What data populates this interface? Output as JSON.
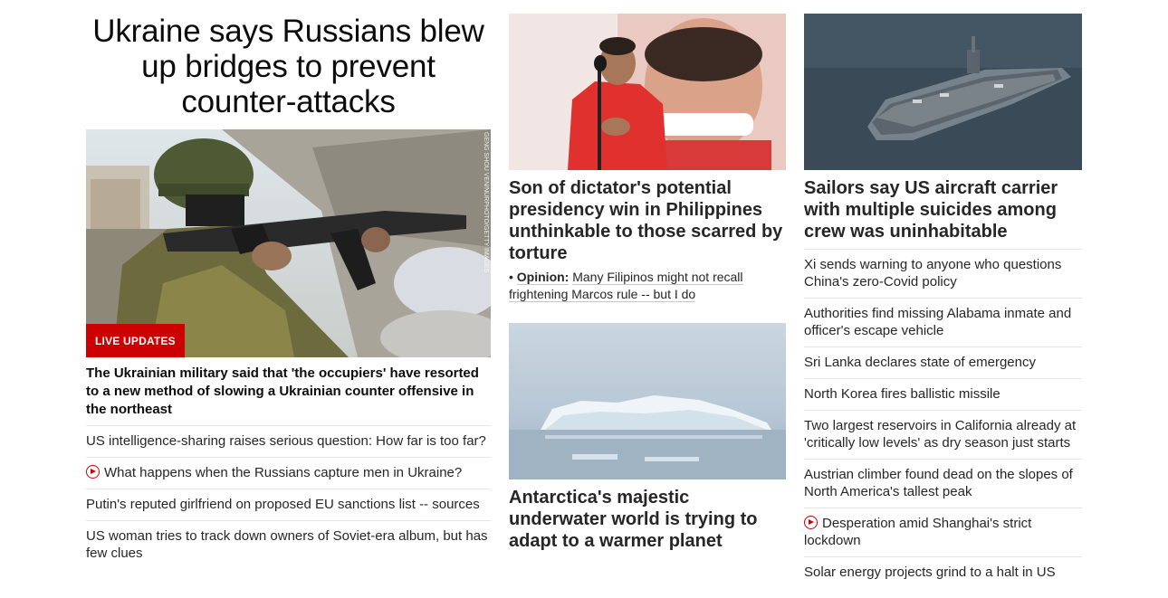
{
  "column1": {
    "hero_title": "Ukraine says Russians blew up bridges to prevent counter-attacks",
    "image_credit": "GENG SHOU VEN/NURPHOTO/GETTY IMAGES",
    "badge": "LIVE UPDATES",
    "sub_headline": "The Ukrainian military said that 'the occupiers' have resorted to a new method of slowing a Ukrainian counter offensive in the northeast",
    "links": [
      {
        "text": "US intelligence-sharing raises serious question: How far is too far?",
        "video": false
      },
      {
        "text": "What happens when the Russians capture men in Ukraine?",
        "video": true
      },
      {
        "text": "Putin's reputed girlfriend on proposed EU sanctions list -- sources",
        "video": false
      },
      {
        "text": "US woman tries to track down owners of Soviet-era album, but has few clues",
        "video": false
      }
    ]
  },
  "column2": {
    "story1": {
      "headline": "Son of dictator's potential presidency win in Philippines unthinkable to those scarred by torture",
      "opinion_label": "Opinion:",
      "opinion_text": "Many Filipinos might not recall frightening Marcos rule -- but I do"
    },
    "story2": {
      "headline": "Antarctica's majestic underwater world is trying to adapt to a warmer planet"
    }
  },
  "column3": {
    "headline": "Sailors say US aircraft carrier with multiple suicides among crew was uninhabitable",
    "links": [
      {
        "text": "Xi sends warning to anyone who questions China's zero-Covid policy",
        "video": false
      },
      {
        "text": "Authorities find missing Alabama inmate and officer's escape vehicle",
        "video": false
      },
      {
        "text": "Sri Lanka declares state of emergency",
        "video": false
      },
      {
        "text": "North Korea fires ballistic missile",
        "video": false
      },
      {
        "text": "Two largest reservoirs in California already at 'critically low levels' as dry season just starts",
        "video": false
      },
      {
        "text": "Austrian climber found dead on the slopes of North America's tallest peak",
        "video": false
      },
      {
        "text": "Desperation amid Shanghai's strict lockdown",
        "video": true
      },
      {
        "text": "Solar energy projects grind to a halt in US",
        "video": false
      }
    ]
  },
  "colors": {
    "accent": "#cc0000",
    "text": "#262626",
    "divider": "#e6e6e6"
  },
  "icons": {
    "video": "play-circle-icon"
  }
}
